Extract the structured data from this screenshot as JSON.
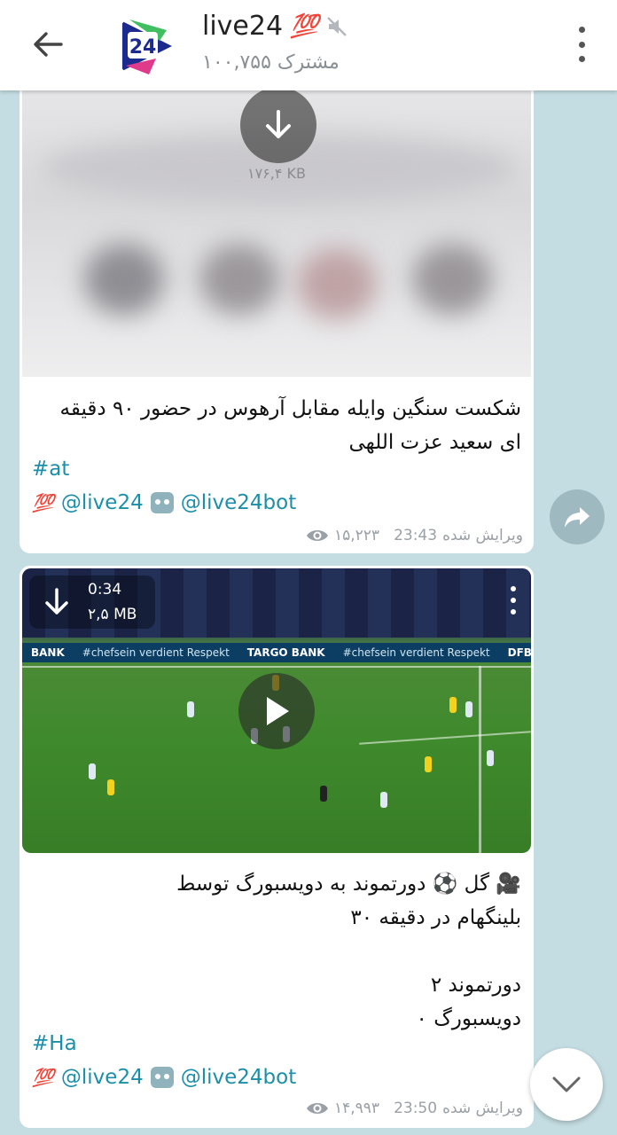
{
  "header": {
    "title": "live24",
    "title_emoji": "💯",
    "subscribers": "۱۰۰,۷۵۵ مشترک",
    "avatar_text": "24"
  },
  "messages": [
    {
      "download_size": "۱۷۶,۴ KB",
      "text": "شکست سنگین وایله مقابل آرهوس در حضور ۹۰ دقیقه ای سعید عزت اللهی",
      "hashtag": "#at",
      "hundred": "💯",
      "link1": "@live24",
      "link2": "@live24bot",
      "edited": "ویرایش شده",
      "time": "23:43",
      "views": "۱۵,۲۲۳"
    },
    {
      "video_duration": "0:34",
      "video_size": "۲,۵ MB",
      "ad_texts": [
        "BANK",
        "#chefsein verdient Respekt",
        "TARGO BANK",
        "#chefsein verdient Respekt",
        "DFB-POKAL"
      ],
      "text_lines": [
        "🎥 گل ⚽ دورتموند به دویسبورگ توسط",
        "بلینگهام در دقیقه ۳۰",
        "",
        "دورتموند ۲",
        "دویسبورگ ۰"
      ],
      "hashtag": "#Ha",
      "hundred": "💯",
      "link1": "@live24",
      "link2": "@live24bot",
      "edited": "ویرایش شده",
      "time": "23:50",
      "views": "۱۴,۹۹۳"
    }
  ],
  "colors": {
    "background": "#c4dde2",
    "link": "#1c8fa8",
    "accent_red": "#e53935"
  }
}
